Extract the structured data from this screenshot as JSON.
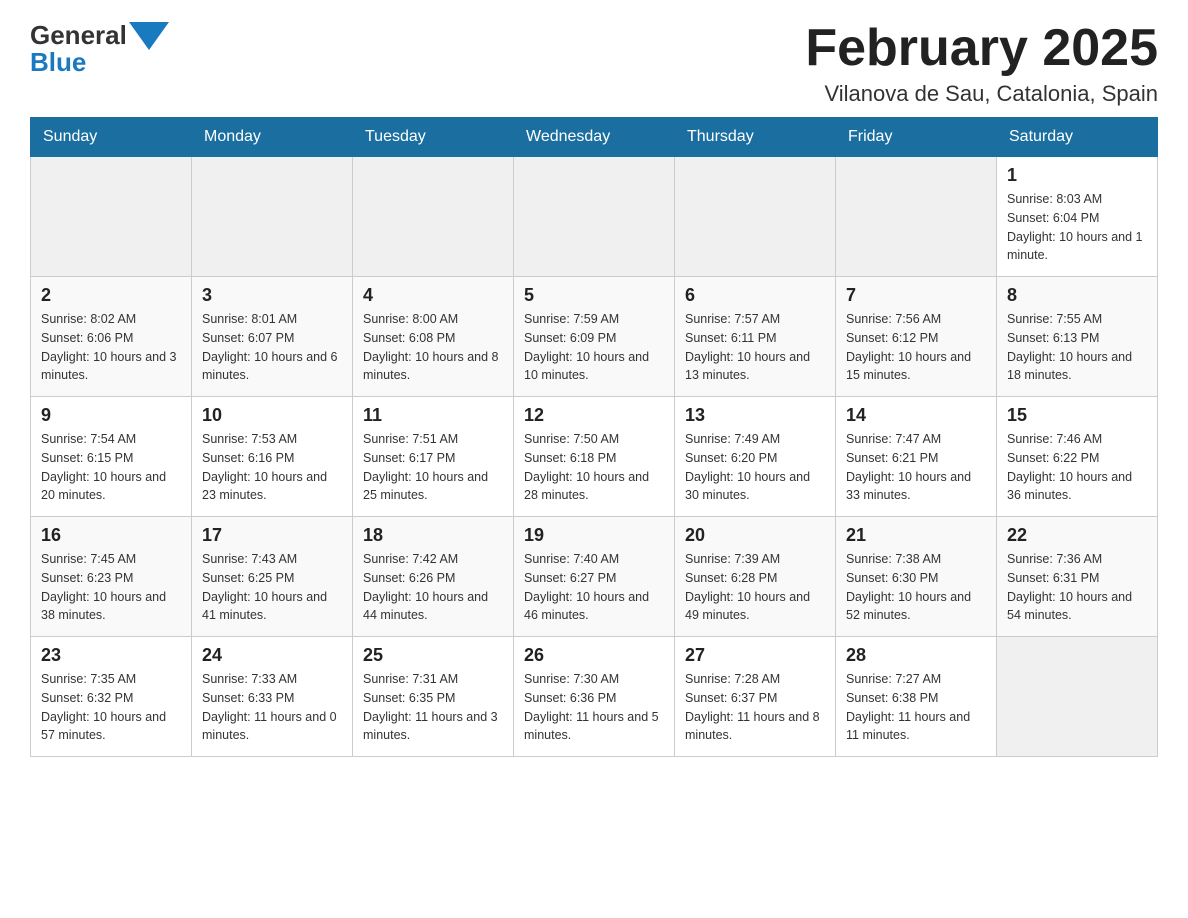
{
  "header": {
    "logo_general": "General",
    "logo_blue": "Blue",
    "title": "February 2025",
    "subtitle": "Vilanova de Sau, Catalonia, Spain"
  },
  "weekdays": [
    "Sunday",
    "Monday",
    "Tuesday",
    "Wednesday",
    "Thursday",
    "Friday",
    "Saturday"
  ],
  "weeks": [
    [
      {
        "day": "",
        "info": ""
      },
      {
        "day": "",
        "info": ""
      },
      {
        "day": "",
        "info": ""
      },
      {
        "day": "",
        "info": ""
      },
      {
        "day": "",
        "info": ""
      },
      {
        "day": "",
        "info": ""
      },
      {
        "day": "1",
        "info": "Sunrise: 8:03 AM\nSunset: 6:04 PM\nDaylight: 10 hours and 1 minute."
      }
    ],
    [
      {
        "day": "2",
        "info": "Sunrise: 8:02 AM\nSunset: 6:06 PM\nDaylight: 10 hours and 3 minutes."
      },
      {
        "day": "3",
        "info": "Sunrise: 8:01 AM\nSunset: 6:07 PM\nDaylight: 10 hours and 6 minutes."
      },
      {
        "day": "4",
        "info": "Sunrise: 8:00 AM\nSunset: 6:08 PM\nDaylight: 10 hours and 8 minutes."
      },
      {
        "day": "5",
        "info": "Sunrise: 7:59 AM\nSunset: 6:09 PM\nDaylight: 10 hours and 10 minutes."
      },
      {
        "day": "6",
        "info": "Sunrise: 7:57 AM\nSunset: 6:11 PM\nDaylight: 10 hours and 13 minutes."
      },
      {
        "day": "7",
        "info": "Sunrise: 7:56 AM\nSunset: 6:12 PM\nDaylight: 10 hours and 15 minutes."
      },
      {
        "day": "8",
        "info": "Sunrise: 7:55 AM\nSunset: 6:13 PM\nDaylight: 10 hours and 18 minutes."
      }
    ],
    [
      {
        "day": "9",
        "info": "Sunrise: 7:54 AM\nSunset: 6:15 PM\nDaylight: 10 hours and 20 minutes."
      },
      {
        "day": "10",
        "info": "Sunrise: 7:53 AM\nSunset: 6:16 PM\nDaylight: 10 hours and 23 minutes."
      },
      {
        "day": "11",
        "info": "Sunrise: 7:51 AM\nSunset: 6:17 PM\nDaylight: 10 hours and 25 minutes."
      },
      {
        "day": "12",
        "info": "Sunrise: 7:50 AM\nSunset: 6:18 PM\nDaylight: 10 hours and 28 minutes."
      },
      {
        "day": "13",
        "info": "Sunrise: 7:49 AM\nSunset: 6:20 PM\nDaylight: 10 hours and 30 minutes."
      },
      {
        "day": "14",
        "info": "Sunrise: 7:47 AM\nSunset: 6:21 PM\nDaylight: 10 hours and 33 minutes."
      },
      {
        "day": "15",
        "info": "Sunrise: 7:46 AM\nSunset: 6:22 PM\nDaylight: 10 hours and 36 minutes."
      }
    ],
    [
      {
        "day": "16",
        "info": "Sunrise: 7:45 AM\nSunset: 6:23 PM\nDaylight: 10 hours and 38 minutes."
      },
      {
        "day": "17",
        "info": "Sunrise: 7:43 AM\nSunset: 6:25 PM\nDaylight: 10 hours and 41 minutes."
      },
      {
        "day": "18",
        "info": "Sunrise: 7:42 AM\nSunset: 6:26 PM\nDaylight: 10 hours and 44 minutes."
      },
      {
        "day": "19",
        "info": "Sunrise: 7:40 AM\nSunset: 6:27 PM\nDaylight: 10 hours and 46 minutes."
      },
      {
        "day": "20",
        "info": "Sunrise: 7:39 AM\nSunset: 6:28 PM\nDaylight: 10 hours and 49 minutes."
      },
      {
        "day": "21",
        "info": "Sunrise: 7:38 AM\nSunset: 6:30 PM\nDaylight: 10 hours and 52 minutes."
      },
      {
        "day": "22",
        "info": "Sunrise: 7:36 AM\nSunset: 6:31 PM\nDaylight: 10 hours and 54 minutes."
      }
    ],
    [
      {
        "day": "23",
        "info": "Sunrise: 7:35 AM\nSunset: 6:32 PM\nDaylight: 10 hours and 57 minutes."
      },
      {
        "day": "24",
        "info": "Sunrise: 7:33 AM\nSunset: 6:33 PM\nDaylight: 11 hours and 0 minutes."
      },
      {
        "day": "25",
        "info": "Sunrise: 7:31 AM\nSunset: 6:35 PM\nDaylight: 11 hours and 3 minutes."
      },
      {
        "day": "26",
        "info": "Sunrise: 7:30 AM\nSunset: 6:36 PM\nDaylight: 11 hours and 5 minutes."
      },
      {
        "day": "27",
        "info": "Sunrise: 7:28 AM\nSunset: 6:37 PM\nDaylight: 11 hours and 8 minutes."
      },
      {
        "day": "28",
        "info": "Sunrise: 7:27 AM\nSunset: 6:38 PM\nDaylight: 11 hours and 11 minutes."
      },
      {
        "day": "",
        "info": ""
      }
    ]
  ]
}
